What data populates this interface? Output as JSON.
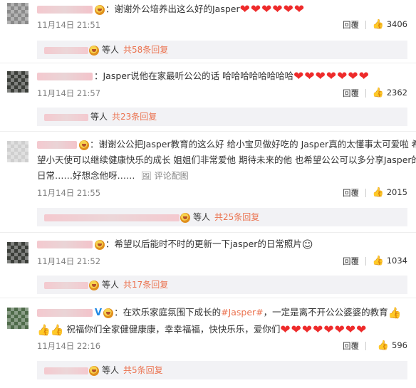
{
  "comments": [
    {
      "text": "：谢谢外公培养出这么好的Jasper",
      "hearts": "❤❤❤❤❤❤",
      "time": "11月14日 21:51",
      "reply": "回覆",
      "likes": "3406",
      "replies_people": "等人",
      "replies_count": "共58条回复"
    },
    {
      "text": "：Jasper说他在家最听公公的话 哈哈哈哈哈哈哈哈",
      "hearts": "❤❤❤❤❤❤❤",
      "time": "11月14日 21:57",
      "reply": "回覆",
      "likes": "2362",
      "replies_people": "等人",
      "replies_count": "共23条回复"
    },
    {
      "line1": "：谢谢公公把Jasper教育的这么好 给小宝贝做好吃的 Jasper真的太懂事太可爱啦 希",
      "line2": "望小天使可以继续健康快乐的成长 姐姐们非常爱他 期待未来的他 也希望公公可以多分享Jasper的",
      "line3": "日常……好想念他呀……",
      "pic_link": "评论配图",
      "time": "11月14日 21:55",
      "reply": "回覆",
      "likes": "2015",
      "replies_people": "等人",
      "replies_count": "共25条回复"
    },
    {
      "text": "：希望以后能时不时的更新一下jasper的日常照片",
      "emoji": "☺",
      "time": "11月14日 21:52",
      "reply": "回覆",
      "likes": "1034",
      "replies_people": "等人",
      "replies_count": "共17条回复"
    },
    {
      "verified": "V",
      "text_before": "：在欢乐家庭氛围下成长的",
      "topic": "#Jasper#",
      "text_after": "，一定是离不开公公婆婆的教育",
      "line2": "祝福你们全家健健康康，幸幸福福，快快乐乐，爱你们",
      "hearts": "❤❤❤❤❤❤❤❤",
      "thumb_emoji": "👍",
      "time": "11月14日 22:16",
      "reply": "回覆",
      "likes": "596",
      "replies_people": "等人",
      "replies_count": "共5条回复"
    }
  ],
  "icons": {
    "like": "thumbs-up-icon",
    "picture": "image-icon",
    "badge": "emoji-crown-badge-icon"
  },
  "colors": {
    "link": "#eb7350",
    "heart": "#ee2b2b",
    "reply_bg": "#f2f2f5"
  }
}
